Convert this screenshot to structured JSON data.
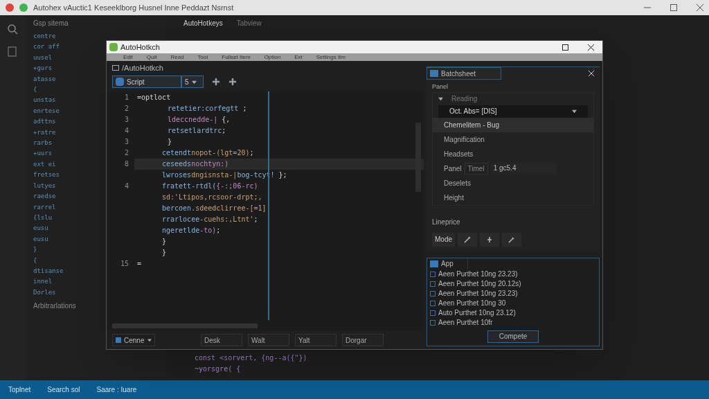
{
  "outer_window": {
    "title": "Autohex vAuctic1 Keseeklborg Husnel Inne Peddazt Nsrnst"
  },
  "background": {
    "sidebar_title": "Gsp sitema",
    "sidebar_lines": [
      "centre",
      "cor aff",
      "uusel",
      "+gurs",
      "atasse",
      "{",
      "unstas",
      "enrtese",
      "adttns",
      "+ratre",
      "rarbs",
      "+uurs",
      "ext ei",
      "fretses",
      "lutyes",
      "raedse",
      "rarrel",
      "{lslu",
      "eusu",
      "eusu",
      "}",
      "{",
      "dtisanse",
      "innel",
      "Dorles"
    ],
    "sidebar_footer": "Arbitrarlations",
    "editor_tabs": [
      {
        "label": "AutoHotkeys",
        "selected": true
      },
      {
        "label": "Tabview",
        "selected": false
      }
    ],
    "code_lines": [
      "const <sorvert, {ng--a({\"})",
      "~yorsgre( {"
    ]
  },
  "dialog": {
    "title": "AutoHotkch",
    "menu": [
      "Edit",
      "Quit",
      "Read",
      "Tool",
      "Fullset Item",
      "Option",
      "Ext",
      "Settings Itm"
    ],
    "path": "/AutoHotkch",
    "tabs": [
      {
        "label": "Script",
        "selected": true
      }
    ],
    "tab_dropdown": "5",
    "code": [
      {
        "number": "1",
        "parts": [
          {
            "kind": "plain",
            "text": "=optloct"
          }
        ],
        "current": false
      },
      {
        "number": "2",
        "parts": [
          {
            "kind": "ident",
            "text": "retetier:corfegtt"
          },
          {
            "kind": "plain",
            "text": " ;"
          }
        ],
        "current": false
      },
      {
        "number": "3",
        "parts": [
          {
            "kind": "keyword",
            "text": "ldeccnedde-|"
          },
          {
            "kind": "plain",
            "text": " {,"
          }
        ],
        "current": false
      },
      {
        "number": "4",
        "parts": [
          {
            "kind": "ident",
            "text": "retsetlardtrc"
          },
          {
            "kind": "plain",
            "text": ";"
          }
        ],
        "current": false
      },
      {
        "number": "3",
        "parts": [
          {
            "kind": "plain",
            "text": "}"
          }
        ],
        "current": false
      },
      {
        "number": "2",
        "parts": [
          {
            "kind": "ident",
            "text": "cetendt"
          },
          {
            "kind": "string",
            "text": "nopot-(lgt=20)"
          },
          {
            "kind": "plain",
            "text": ";"
          }
        ],
        "current": false
      },
      {
        "number": "8",
        "parts": [
          {
            "kind": "ident",
            "text": "ceseeds"
          },
          {
            "kind": "keyword",
            "text": "nochtyn:)"
          }
        ],
        "current": true
      },
      {
        "parts": [
          {
            "kind": "ident",
            "text": "lwroses"
          },
          {
            "kind": "string",
            "text": "dngisnsta-|"
          },
          {
            "kind": "ident",
            "text": "bog-tcyt!"
          },
          {
            "kind": "plain",
            "text": " };"
          }
        ],
        "current": false
      },
      {
        "number": "4",
        "parts": [
          {
            "kind": "ident",
            "text": "fratett-rtdl("
          },
          {
            "kind": "keyword",
            "text": "{-:;06-rc)"
          }
        ],
        "current": false
      },
      {
        "parts": [
          {
            "kind": "string",
            "text": "sd:'Ltipos,rcsoor-drpt;,"
          }
        ],
        "current": false
      },
      {
        "parts": [
          {
            "kind": "ident",
            "text": "bercoen."
          },
          {
            "kind": "string",
            "text": "sdeedclirree-[=1]"
          }
        ],
        "current": false
      },
      {
        "parts": [
          {
            "kind": "ident",
            "text": "rrarlocee-"
          },
          {
            "kind": "string",
            "text": "cuehs:,Ltnt'"
          },
          {
            "kind": "plain",
            "text": ";"
          }
        ],
        "current": false
      },
      {
        "parts": [
          {
            "kind": "ident",
            "text": "ngeretlde-"
          },
          {
            "kind": "keyword",
            "text": "to)"
          },
          {
            "kind": "plain",
            "text": ";"
          }
        ],
        "current": false
      },
      {
        "parts": [
          {
            "kind": "plain",
            "text": "}"
          }
        ],
        "current": false
      },
      {
        "parts": [
          {
            "kind": "plain",
            "text": "}"
          }
        ],
        "current": false
      },
      {
        "number": "15",
        "parts": [
          {
            "kind": "plain",
            "text": "="
          }
        ],
        "current": false
      }
    ],
    "bottom_dropdown": "Cenne",
    "bottom_buttons": [
      "Desk",
      "Walt",
      "Yalt",
      "Dorgar"
    ],
    "panel": {
      "tab": "Batchsheet",
      "label": "Panel",
      "rows": [
        {
          "kind": "header",
          "text": "Reading"
        },
        {
          "kind": "select",
          "text": "Oct. Abs= [DIS]"
        },
        {
          "kind": "item",
          "text": "Chemelitem - Bug",
          "selected": true
        },
        {
          "kind": "item",
          "text": "Magnification",
          "selected": false
        },
        {
          "kind": "item",
          "text": "Headsets",
          "selected": false
        },
        {
          "kind": "field",
          "text": "Panel",
          "field_label": "Timel",
          "value": "1 gc5.4"
        },
        {
          "kind": "item",
          "text": "Deselets",
          "selected": false
        },
        {
          "kind": "item",
          "text": "Height",
          "selected": false
        }
      ],
      "section": "Lineprice",
      "mode": "Mode"
    },
    "list": {
      "tab": "App",
      "items": [
        {
          "text": "Aeen Purthet 10ng 23.23)",
          "checked": false
        },
        {
          "text": "Aeen Purthet 10ng 20.12s)",
          "checked": false
        },
        {
          "text": "Aeen Purthet 10ng 23.23)",
          "checked": false
        },
        {
          "text": "Aeen Purthet 10ng 30",
          "checked": false
        },
        {
          "text": "Auto Purthet 10ng 23.12)",
          "checked": false
        },
        {
          "text": "Aeen Purthet 10fr",
          "checked": false
        }
      ],
      "button": "Compete"
    }
  },
  "status_bar": [
    "Toplnet",
    "Search sol",
    "Saare : Iuare"
  ]
}
